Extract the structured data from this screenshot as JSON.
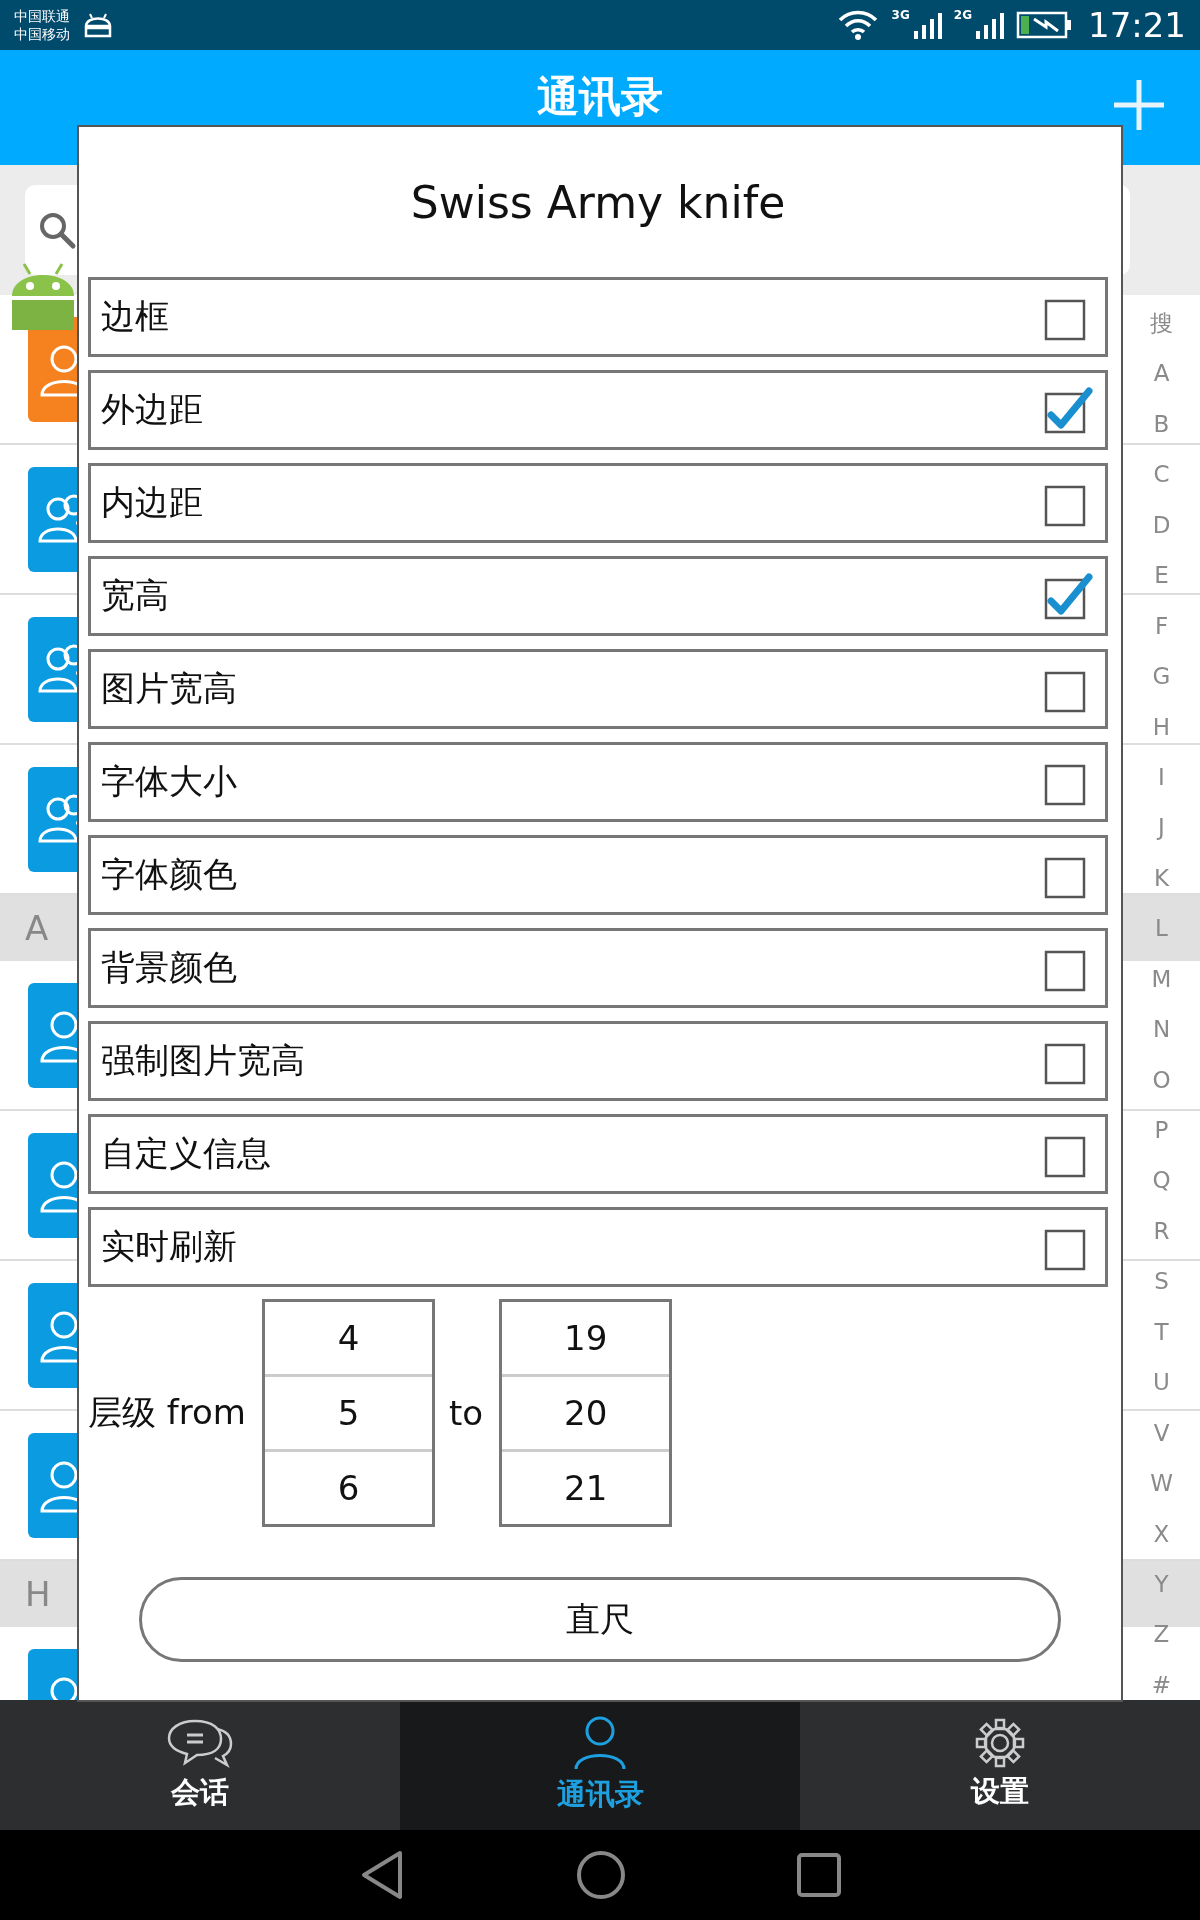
{
  "status_bar": {
    "carriers": [
      "中国联通",
      "中国移动"
    ],
    "network_labels": [
      "3G",
      "2G"
    ],
    "time": "17:21"
  },
  "app_bar": {
    "title": "通讯录"
  },
  "contact_rows": [
    {
      "kind": "person",
      "color": "#f5821f"
    },
    {
      "kind": "group",
      "color": "#0a9be0"
    },
    {
      "kind": "group",
      "color": "#0a9be0"
    },
    {
      "kind": "group",
      "color": "#0a9be0"
    },
    {
      "kind": "header",
      "label": "A"
    },
    {
      "kind": "person",
      "color": "#0a9be0"
    },
    {
      "kind": "person",
      "color": "#0a9be0"
    },
    {
      "kind": "person",
      "color": "#0a9be0"
    },
    {
      "kind": "person",
      "color": "#0a9be0"
    },
    {
      "kind": "header",
      "label": "H"
    },
    {
      "kind": "person",
      "color": "#0a9be0"
    }
  ],
  "index": [
    "搜",
    "A",
    "B",
    "C",
    "D",
    "E",
    "F",
    "G",
    "H",
    "I",
    "J",
    "K",
    "L",
    "M",
    "N",
    "O",
    "P",
    "Q",
    "R",
    "S",
    "T",
    "U",
    "V",
    "W",
    "X",
    "Y",
    "Z",
    "#"
  ],
  "dialog": {
    "title": "Swiss Army knife",
    "options": [
      {
        "label": "边框",
        "checked": false
      },
      {
        "label": "外边距",
        "checked": true
      },
      {
        "label": "内边距",
        "checked": false
      },
      {
        "label": "宽高",
        "checked": true
      },
      {
        "label": "图片宽高",
        "checked": false
      },
      {
        "label": "字体大小",
        "checked": false
      },
      {
        "label": "字体颜色",
        "checked": false
      },
      {
        "label": "背景颜色",
        "checked": false
      },
      {
        "label": "强制图片宽高",
        "checked": false
      },
      {
        "label": "自定义信息",
        "checked": false
      },
      {
        "label": "实时刷新",
        "checked": false
      }
    ],
    "level_range": {
      "label": "层级 from",
      "separator": "to",
      "from_picker": [
        "4",
        "5",
        "6"
      ],
      "to_picker": [
        "19",
        "20",
        "21"
      ]
    },
    "button": "直尺"
  },
  "bottom_nav": [
    {
      "label": "会话",
      "kind": "chat",
      "selected": false
    },
    {
      "label": "通讯录",
      "kind": "contacts",
      "selected": true
    },
    {
      "label": "设置",
      "kind": "settings",
      "selected": false
    }
  ]
}
